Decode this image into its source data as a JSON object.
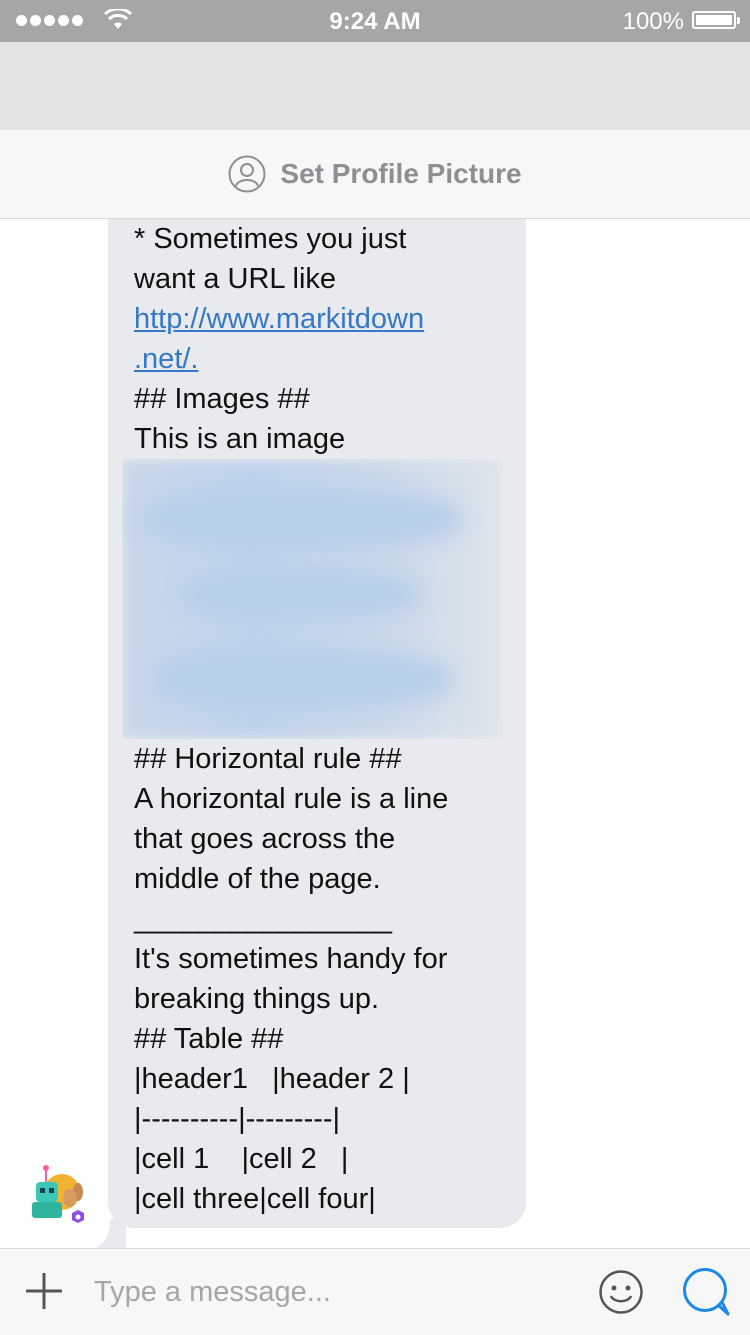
{
  "status": {
    "time": "9:24 AM",
    "battery": "100%"
  },
  "header": {
    "profile_label": "Set Profile Picture"
  },
  "message": {
    "lines_before_image": [
      "* Sometimes you just",
      "want a URL like",
      "http://www.markitdown",
      ".net/.",
      "## Images ##",
      "This is an image"
    ],
    "lines_after_image": [
      "## Horizontal rule ##",
      "A horizontal rule is a line",
      "that goes across the",
      "middle of the page.",
      "________________",
      "It's sometimes handy for",
      "breaking things up.",
      "## Table ##",
      "|header1   |header 2 |",
      "|----------|---------|",
      "|cell 1    |cell 2   |",
      "|cell three|cell four|"
    ]
  },
  "composer": {
    "placeholder": "Type a message..."
  },
  "colors": {
    "link": "#3478c6",
    "bubble": "#e9eaee",
    "send_accent": "#1e88e5",
    "status_bar": "#a6a6a6"
  },
  "icons": [
    "signal-dots-icon",
    "wifi-icon",
    "battery-icon",
    "profile-icon",
    "plus-icon",
    "emoji-icon",
    "send-icon"
  ]
}
